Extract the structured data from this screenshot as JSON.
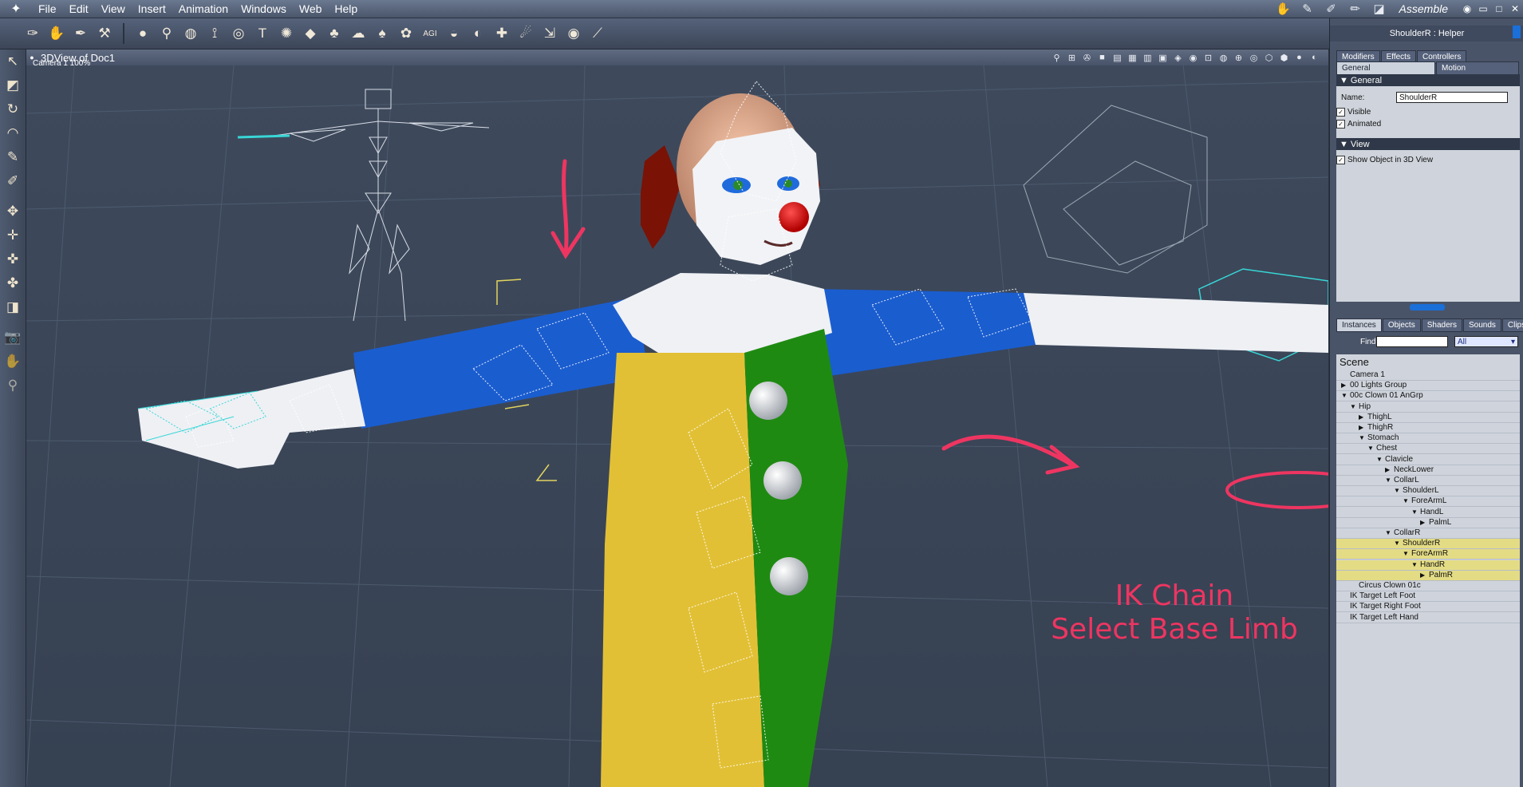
{
  "menubar": {
    "logo": "✦",
    "items": [
      "File",
      "Edit",
      "View",
      "Insert",
      "Animation",
      "Windows",
      "Web",
      "Help"
    ],
    "room_icons": [
      "✋",
      "✎",
      "✐",
      "✏",
      "◪"
    ],
    "room_label": "Assemble",
    "window_buttons": [
      "◉",
      "▭",
      "□",
      "✕"
    ]
  },
  "toolbar": {
    "icons_left": [
      "✑",
      "✋",
      "✒",
      "⚒"
    ],
    "icons_right": [
      "●",
      "⚲",
      "◍",
      "⟟",
      "◎",
      "T",
      "✺",
      "◆",
      "♣",
      "☁",
      "♠",
      "✿",
      "AGI",
      "◒",
      "◐",
      "✚",
      "☄",
      "⇲",
      "◉",
      "⟋"
    ]
  },
  "leftstrip": {
    "tools": [
      "↖",
      "◩",
      "↻",
      "◠",
      "✎",
      "✐",
      "✥",
      "✛",
      "✜",
      "✤",
      "◨",
      "📷",
      "✋",
      "⚲"
    ]
  },
  "viewport": {
    "title": "3DView of Doc1",
    "camera_label": "Camera 1 100%",
    "tools": [
      "⚲",
      "⊞",
      "✇",
      "■",
      "▤",
      "▦",
      "▥",
      "▣",
      "◈",
      "◉",
      "⊡",
      "◍",
      "⊕",
      "◎",
      "⬡",
      "⬢",
      "●",
      "◐"
    ]
  },
  "panel": {
    "title": "ShoulderR : Helper",
    "tabs_top": [
      "Modifiers",
      "Effects",
      "Controllers"
    ],
    "tabs_bottom": [
      "General",
      "Motion"
    ],
    "section_general": "General",
    "name_label": "Name:",
    "name_value": "ShoulderR",
    "visible_label": "Visible",
    "animated_label": "Animated",
    "section_view": "View",
    "show_label": "Show Object in 3D View",
    "scene_tabs": [
      "Instances",
      "Objects",
      "Shaders",
      "Sounds",
      "Clips"
    ],
    "find_label": "Find:",
    "filter_value": "All",
    "scene_label": "Scene",
    "tree": [
      {
        "label": "Camera 1",
        "depth": 0,
        "tri": ""
      },
      {
        "label": "00 Lights Group",
        "depth": 0,
        "tri": "▶"
      },
      {
        "label": "00c Clown 01 AnGrp",
        "depth": 0,
        "tri": "▼"
      },
      {
        "label": "Hip",
        "depth": 1,
        "tri": "▼"
      },
      {
        "label": "ThighL",
        "depth": 2,
        "tri": "▶"
      },
      {
        "label": "ThighR",
        "depth": 2,
        "tri": "▶"
      },
      {
        "label": "Stomach",
        "depth": 2,
        "tri": "▼"
      },
      {
        "label": "Chest",
        "depth": 3,
        "tri": "▼"
      },
      {
        "label": "Clavicle",
        "depth": 4,
        "tri": "▼"
      },
      {
        "label": "NeckLower",
        "depth": 5,
        "tri": "▶"
      },
      {
        "label": "CollarL",
        "depth": 5,
        "tri": "▼"
      },
      {
        "label": "ShoulderL",
        "depth": 6,
        "tri": "▼"
      },
      {
        "label": "ForeArmL",
        "depth": 7,
        "tri": "▼"
      },
      {
        "label": "HandL",
        "depth": 8,
        "tri": "▼"
      },
      {
        "label": "PalmL",
        "depth": 9,
        "tri": "▶"
      },
      {
        "label": "CollarR",
        "depth": 5,
        "tri": "▼"
      },
      {
        "label": "ShoulderR",
        "depth": 6,
        "tri": "▼",
        "hl": true
      },
      {
        "label": "ForeArmR",
        "depth": 7,
        "tri": "▼",
        "hl": true
      },
      {
        "label": "HandR",
        "depth": 8,
        "tri": "▼",
        "hl": true
      },
      {
        "label": "PalmR",
        "depth": 9,
        "tri": "▶",
        "hl": true
      },
      {
        "label": "Circus Clown 01c",
        "depth": 1,
        "tri": ""
      },
      {
        "label": "IK Target Left Foot",
        "depth": 0,
        "tri": ""
      },
      {
        "label": "IK Target Right Foot",
        "depth": 0,
        "tri": ""
      },
      {
        "label": "IK Target Left Hand",
        "depth": 0,
        "tri": ""
      }
    ]
  },
  "annotation": {
    "line1": "IK Chain",
    "line2": "Select Base Limb"
  },
  "colors": {
    "annotation": "#ee3561",
    "highlight": "#e4dc85",
    "viewport_bg": "#3a4557"
  }
}
